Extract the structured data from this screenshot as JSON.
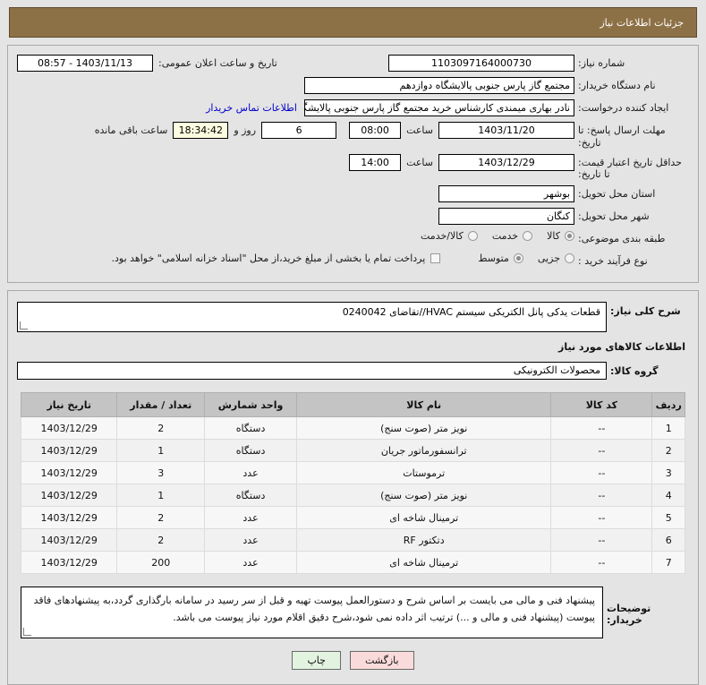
{
  "header": {
    "title": "جزئیات اطلاعات نیاز"
  },
  "form": {
    "need_no": {
      "label": "شماره نیاز:",
      "value": "1103097164000730"
    },
    "pub_date": {
      "label": "تاریخ و ساعت اعلان عمومی:",
      "value": "1403/11/13 - 08:57"
    },
    "buyer_org": {
      "label": "نام دستگاه خریدار:",
      "value": "مجتمع گاز پارس جنوبی  پالایشگاه دوازدهم"
    },
    "creator": {
      "label": "ایجاد کننده درخواست:",
      "value": "نادر بهاری میمندی کارشناس خرید مجتمع گاز پارس جنوبی  پالایشگاه دوازدهم"
    },
    "contact_link": "اطلاعات تماس خریدار",
    "deadline": {
      "label": "مهلت ارسال پاسخ: تا تاریخ:",
      "date": "1403/11/20",
      "time_label": "ساعت",
      "time": "08:00",
      "days": "6",
      "days_sep": "روز و",
      "countdown": "18:34:42",
      "remaining_label": "ساعت باقی مانده"
    },
    "price_validity": {
      "label": "حداقل تاریخ اعتبار قیمت: تا تاریخ:",
      "date": "1403/12/29",
      "time_label": "ساعت",
      "time": "14:00"
    },
    "province": {
      "label": "استان محل تحویل:",
      "value": "بوشهر"
    },
    "city": {
      "label": "شهر محل تحویل:",
      "value": "کنگان"
    },
    "category": {
      "label": "طبقه بندی موضوعی:",
      "options": [
        {
          "label": "کالا",
          "selected": true
        },
        {
          "label": "خدمت",
          "selected": false
        },
        {
          "label": "کالا/خدمت",
          "selected": false
        }
      ]
    },
    "process_type": {
      "label": "نوع فرآیند خرید :",
      "options": [
        {
          "label": "جزیی",
          "selected": false
        },
        {
          "label": "متوسط",
          "selected": true
        }
      ],
      "checkbox_checked": false,
      "note": "پرداخت تمام یا بخشی از مبلغ خرید،از محل \"اسناد خزانه اسلامی\" خواهد بود."
    }
  },
  "summary": {
    "label": "شرح کلی نیاز:",
    "value": "قطعات یدکی پانل الکتریکی سیستم HVAC//تقاضای 0240042"
  },
  "goods_section_title": "اطلاعات کالاهای مورد نیاز",
  "goods_group": {
    "label": "گروه کالا:",
    "value": "محصولات الکترونیکی"
  },
  "table": {
    "columns": [
      "ردیف",
      "کد کالا",
      "نام کالا",
      "واحد شمارش",
      "تعداد / مقدار",
      "تاریخ نیاز"
    ],
    "rows": [
      {
        "radif": "1",
        "code": "--",
        "name": "نویز متر (صوت سنج)",
        "unit": "دستگاه",
        "qty": "2",
        "date": "1403/12/29",
        "highlight": false
      },
      {
        "radif": "2",
        "code": "--",
        "name": "ترانسفورماتور جریان",
        "unit": "دستگاه",
        "qty": "1",
        "date": "1403/12/29",
        "highlight": true
      },
      {
        "radif": "3",
        "code": "--",
        "name": "ترموستات",
        "unit": "عدد",
        "qty": "3",
        "date": "1403/12/29",
        "highlight": false
      },
      {
        "radif": "4",
        "code": "--",
        "name": "نویز متر (صوت سنج)",
        "unit": "دستگاه",
        "qty": "1",
        "date": "1403/12/29",
        "highlight": false
      },
      {
        "radif": "5",
        "code": "--",
        "name": "ترمینال شاخه ای",
        "unit": "عدد",
        "qty": "2",
        "date": "1403/12/29",
        "highlight": false
      },
      {
        "radif": "6",
        "code": "--",
        "name": "دتکتور RF",
        "unit": "عدد",
        "qty": "2",
        "date": "1403/12/29",
        "highlight": false
      },
      {
        "radif": "7",
        "code": "--",
        "name": "ترمینال شاخه ای",
        "unit": "عدد",
        "qty": "200",
        "date": "1403/12/29",
        "highlight": false
      }
    ]
  },
  "buyer_notes": {
    "label": "توضیحات خریدار:",
    "value": "پیشنهاد فنی و مالی می بایست بر اساس شرح و دستورالعمل پیوست تهیه و قبل از سر رسید در سامانه بارگذاری گردد،به پیشنهادهای فاقد پیوست (پیشنهاد فنی و مالی و ...) ترتیب اثر داده نمی شود،شرح دقیق اقلام مورد نیاز پیوست می باشد."
  },
  "footer": {
    "back_label": "بازگشت",
    "print_label": "چاپ"
  },
  "colors": {
    "header_bg": "#8d7146",
    "highlight_text": "#b85c00",
    "link": "#0000cc",
    "back_btn": "#fadbdb",
    "print_btn": "#e2f3df"
  }
}
